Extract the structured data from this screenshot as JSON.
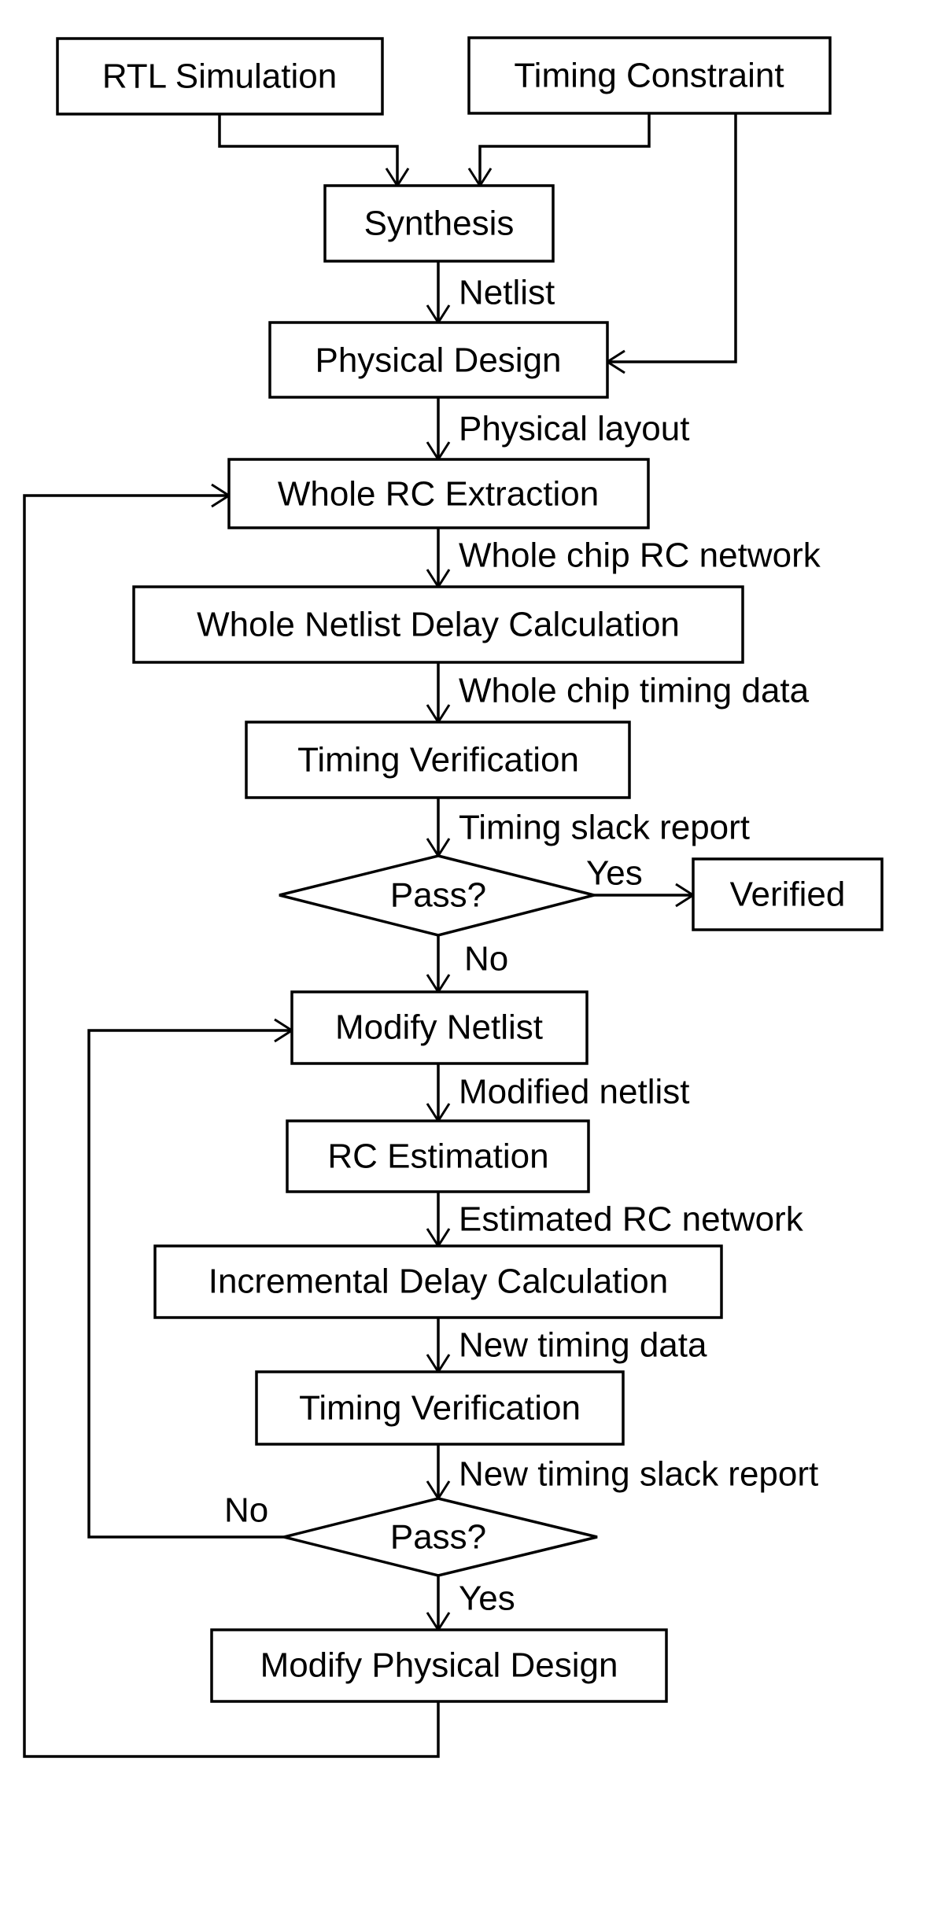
{
  "diagram": {
    "type": "flowchart",
    "nodes": {
      "rtl_simulation": "RTL Simulation",
      "timing_constraint": "Timing Constraint",
      "synthesis": "Synthesis",
      "physical_design": "Physical Design",
      "whole_rc_extraction": "Whole RC Extraction",
      "whole_netlist_delay": "Whole Netlist Delay Calculation",
      "timing_verification_1": "Timing Verification",
      "pass_1": "Pass?",
      "verified": "Verified",
      "modify_netlist": "Modify Netlist",
      "rc_estimation": "RC Estimation",
      "incremental_delay": "Incremental Delay Calculation",
      "timing_verification_2": "Timing Verification",
      "pass_2": "Pass?",
      "modify_physical_design": "Modify Physical Design"
    },
    "edge_labels": {
      "netlist": "Netlist",
      "physical_layout": "Physical layout",
      "whole_chip_rc": "Whole chip RC network",
      "whole_chip_timing": "Whole chip timing data",
      "timing_slack": "Timing slack report",
      "yes_1": "Yes",
      "no_1": "No",
      "modified_netlist": "Modified netlist",
      "estimated_rc": "Estimated RC network",
      "new_timing_data": "New timing data",
      "new_slack": "New timing slack report",
      "no_2": "No",
      "yes_2": "Yes"
    },
    "edges": [
      {
        "from": "RTL Simulation",
        "to": "Synthesis"
      },
      {
        "from": "Timing Constraint",
        "to": "Synthesis"
      },
      {
        "from": "Timing Constraint",
        "to": "Physical Design"
      },
      {
        "from": "Synthesis",
        "to": "Physical Design",
        "label": "Netlist"
      },
      {
        "from": "Physical Design",
        "to": "Whole RC Extraction",
        "label": "Physical layout"
      },
      {
        "from": "Whole RC Extraction",
        "to": "Whole Netlist Delay Calculation",
        "label": "Whole chip RC network"
      },
      {
        "from": "Whole Netlist Delay Calculation",
        "to": "Timing Verification",
        "label": "Whole chip timing data"
      },
      {
        "from": "Timing Verification",
        "to": "Pass?",
        "label": "Timing slack report"
      },
      {
        "from": "Pass?",
        "to": "Verified",
        "label": "Yes"
      },
      {
        "from": "Pass?",
        "to": "Modify Netlist",
        "label": "No"
      },
      {
        "from": "Modify Netlist",
        "to": "RC Estimation",
        "label": "Modified netlist"
      },
      {
        "from": "RC Estimation",
        "to": "Incremental Delay Calculation",
        "label": "Estimated RC network"
      },
      {
        "from": "Incremental Delay Calculation",
        "to": "Timing Verification",
        "label": "New timing data"
      },
      {
        "from": "Timing Verification",
        "to": "Pass?",
        "label": "New timing slack report"
      },
      {
        "from": "Pass?",
        "to": "Modify Netlist",
        "label": "No"
      },
      {
        "from": "Pass?",
        "to": "Modify Physical Design",
        "label": "Yes"
      },
      {
        "from": "Modify Physical Design",
        "to": "Whole RC Extraction"
      }
    ]
  }
}
